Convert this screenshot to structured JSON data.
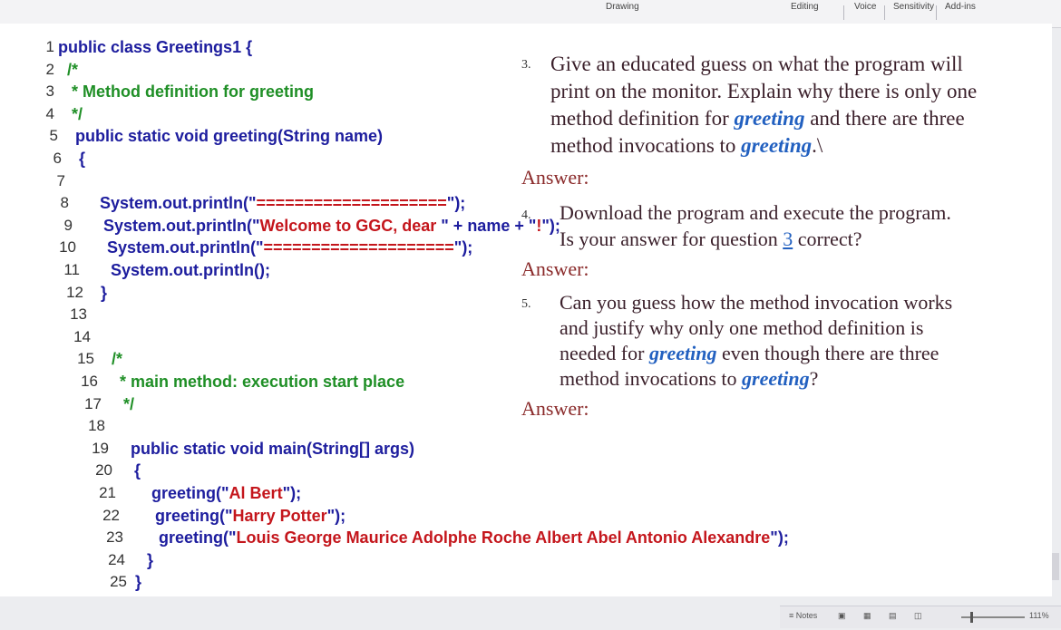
{
  "ribbon": {
    "items": [
      "Drawing",
      "Editing",
      "Voice",
      "Sensitivity",
      "Add-ins"
    ]
  },
  "code": {
    "lines": [
      {
        "n": "1",
        "parts": [
          {
            "t": "public class Greetings1 {",
            "c": "kw"
          }
        ]
      },
      {
        "n": "2",
        "parts": [
          {
            "t": "  /*",
            "c": "cm"
          }
        ]
      },
      {
        "n": "3",
        "parts": [
          {
            "t": "   * Method definition for greeting",
            "c": "cm"
          }
        ]
      },
      {
        "n": "4",
        "parts": [
          {
            "t": "   */",
            "c": "cm"
          }
        ]
      },
      {
        "n": "5",
        "parts": [
          {
            "t": "   public static void greeting(String name)",
            "c": "kw"
          }
        ]
      },
      {
        "n": "6",
        "parts": [
          {
            "t": "   {",
            "c": "kw"
          }
        ]
      },
      {
        "n": "7",
        "parts": []
      },
      {
        "n": "8",
        "parts": [
          {
            "t": "      System.out.println(\"",
            "c": "nm"
          },
          {
            "t": "====================",
            "c": "str"
          },
          {
            "t": "\");",
            "c": "nm"
          }
        ]
      },
      {
        "n": "9",
        "parts": [
          {
            "t": "      System.out.println(\"",
            "c": "nm"
          },
          {
            "t": "Welcome to GGC, dear ",
            "c": "str"
          },
          {
            "t": "\" + name + \"",
            "c": "nm"
          },
          {
            "t": "!",
            "c": "str"
          },
          {
            "t": "\");",
            "c": "nm"
          }
        ]
      },
      {
        "n": "10",
        "parts": [
          {
            "t": "      System.out.println(\"",
            "c": "nm"
          },
          {
            "t": "====================",
            "c": "str"
          },
          {
            "t": "\");",
            "c": "nm"
          }
        ]
      },
      {
        "n": "11",
        "parts": [
          {
            "t": "      System.out.println();",
            "c": "nm"
          }
        ]
      },
      {
        "n": "12",
        "parts": [
          {
            "t": "   }",
            "c": "kw"
          }
        ]
      },
      {
        "n": "13",
        "parts": []
      },
      {
        "n": "14",
        "parts": []
      },
      {
        "n": "15",
        "parts": [
          {
            "t": "   /*",
            "c": "cm"
          }
        ]
      },
      {
        "n": "16",
        "parts": [
          {
            "t": "    * main method: execution start place",
            "c": "cm"
          }
        ]
      },
      {
        "n": "17",
        "parts": [
          {
            "t": "    */",
            "c": "cm"
          }
        ]
      },
      {
        "n": "18",
        "parts": []
      },
      {
        "n": "19",
        "parts": [
          {
            "t": "    public static void main(String[] args)",
            "c": "kw"
          }
        ]
      },
      {
        "n": "20",
        "parts": [
          {
            "t": "    {",
            "c": "kw"
          }
        ]
      },
      {
        "n": "21",
        "parts": [
          {
            "t": "       greeting(\"",
            "c": "nm"
          },
          {
            "t": "Al Bert",
            "c": "str"
          },
          {
            "t": "\");",
            "c": "nm"
          }
        ]
      },
      {
        "n": "22",
        "parts": [
          {
            "t": "       greeting(\"",
            "c": "nm"
          },
          {
            "t": "Harry Potter",
            "c": "str"
          },
          {
            "t": "\");",
            "c": "nm"
          }
        ]
      },
      {
        "n": "23",
        "parts": [
          {
            "t": "       greeting(\"",
            "c": "nm"
          },
          {
            "t": "Louis George Maurice Adolphe Roche Albert Abel Antonio Alexandre",
            "c": "str"
          },
          {
            "t": "\");",
            "c": "nm"
          }
        ]
      },
      {
        "n": "24",
        "parts": [
          {
            "t": "    }",
            "c": "kw"
          }
        ]
      },
      {
        "n": "25",
        "parts": [
          {
            "t": " }",
            "c": "kw"
          }
        ]
      }
    ]
  },
  "questions": {
    "q3": {
      "num": "3.",
      "line1": "Give an educated guess on what the program will",
      "line2": "print on the monitor. Explain why there is only one",
      "line3a": "method definition for ",
      "line3b": "greeting",
      "line3c": " and there are three",
      "line4a": "method invocations to ",
      "line4b": "greeting",
      "line4c": ".\\"
    },
    "a3": "Answer:",
    "q4": {
      "num": "4.",
      "line1": "Download the program and execute the program.",
      "line2a": "Is your answer for question ",
      "line2b": "3",
      "line2c": " correct?"
    },
    "a4": "Answer:",
    "q5": {
      "num": "5.",
      "line1": "Can you guess how the method invocation works",
      "line2": "and justify why only one method definition is",
      "line3a": "needed for ",
      "line3b": "greeting",
      "line3c": " even though there are three",
      "line4a": "method invocations to ",
      "line4b": "greeting",
      "line4c": "?"
    },
    "a5": "Answer:"
  },
  "status": {
    "notes": "Notes",
    "zoom": "111%"
  }
}
